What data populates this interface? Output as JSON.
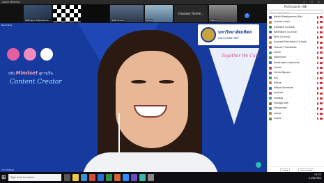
{
  "window": {
    "title": "Zoom Meeting"
  },
  "video_strip": {
    "thumbs": [
      {
        "name": "Natthapol Wiwatgama..."
      },
      {
        "name": ""
      },
      {
        "name": ""
      },
      {
        "name": "Natthakanch"
      },
      {
        "name": "Wimol"
      },
      {
        "name": "Chanany Tiamm..."
      },
      {
        "name": "Mame"
      }
    ]
  },
  "share": {
    "top_left_badge": "Recording",
    "university_th": "มหาวิทยาลัยมหิดล",
    "faculty_th": "คณะเภสัชศาสตร์",
    "poster_text": "Together We Can!",
    "mindset_line1_prefix": "ปรับ",
    "mindset_line1_bold": "Mindset",
    "mindset_line1_suffix": "สู่การเป็น",
    "mindset_line2": "Content Creator",
    "bottom_left_badge": "Annotations"
  },
  "panel": {
    "title": "Participants (48)",
    "search_placeholder": "Find a participant",
    "participants": [
      {
        "name": "Natthi Wiwatgamma (Me)",
        "color": "#5b3b8c"
      },
      {
        "name": "ocfoods (host)",
        "color": "#e07b2b"
      },
      {
        "name": "wuthlakit (Co-host)",
        "color": "#2f8f4e"
      },
      {
        "name": "Natthakorn (Co-host)",
        "color": "#2e6bd6"
      },
      {
        "name": "Wilin (Co-host)",
        "color": "#8a3bb5"
      },
      {
        "name": "Aunhatai Pimcharat (Co-host)",
        "color": "#d6a22e"
      },
      {
        "name": "Chanany Tiamwatee",
        "color": "#c23d6b"
      },
      {
        "name": "anime",
        "color": "#2fa8a1"
      },
      {
        "name": "alfayrinaid",
        "color": "#6b8f2f"
      },
      {
        "name": "Amothuporn iowinlizod",
        "color": "#3b6bc2"
      },
      {
        "name": "chanid",
        "color": "#c2443b"
      },
      {
        "name": "Gerard Nguyen",
        "color": "#7a4bc2"
      },
      {
        "name": "ella",
        "color": "#2f9b5b"
      },
      {
        "name": "iPhone",
        "color": "#e07b2b"
      },
      {
        "name": "Kitaya Kusonavat",
        "color": "#2e6bd6"
      },
      {
        "name": "jaruhida",
        "color": "#b53b8a"
      },
      {
        "name": "lanattaa",
        "color": "#2fa8a1"
      },
      {
        "name": "mosagg aida",
        "color": "#8f6b2f"
      },
      {
        "name": "kmvanintan",
        "color": "#3b8fc2"
      },
      {
        "name": "nakrat",
        "color": "#c2883b"
      },
      {
        "name": "mepid",
        "color": "#5b8c3b"
      }
    ],
    "invite_label": "Invite",
    "unmute_label": "Unmute Me"
  },
  "taskbar": {
    "search_placeholder": "Type here to search",
    "time": "14:32",
    "date": "21/8/2564"
  }
}
